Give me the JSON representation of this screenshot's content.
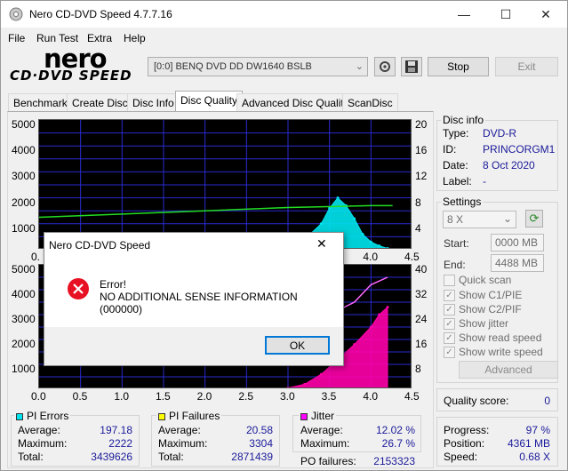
{
  "window": {
    "title": "Nero CD-DVD Speed 4.7.7.16",
    "minimize": "—",
    "maximize": "☐",
    "close": "✕"
  },
  "menu": [
    "File",
    "Run Test",
    "Extra",
    "Help"
  ],
  "logo": {
    "top": "nero",
    "bottom": "CD·DVD SPEED"
  },
  "drive": {
    "selected": "[0:0]   BENQ DVD DD DW1640 BSLB"
  },
  "toolbar": {
    "stop": "Stop",
    "exit": "Exit"
  },
  "tabs": [
    "Benchmark",
    "Create Disc",
    "Disc Info",
    "Disc Quality",
    "Advanced Disc Quality",
    "ScanDisc"
  ],
  "active_tab": "Disc Quality",
  "chart_data": [
    {
      "type": "area",
      "title": "PI Errors / Read speed",
      "xlabel": "",
      "ylabel": "",
      "xlim": [
        0,
        4.5
      ],
      "ylim": [
        0,
        5000
      ],
      "ylim_right": [
        0,
        20
      ],
      "y_ticks_left": [
        "5000",
        "4000",
        "3000",
        "2000",
        "1000"
      ],
      "y_ticks_right": [
        "20",
        "16",
        "12",
        "8",
        "4"
      ],
      "x_ticks_visible": [
        "0.",
        "4.0",
        "4.5"
      ],
      "series": [
        {
          "name": "PI Errors",
          "color": "#00e5ee",
          "x": [
            3.0,
            3.2,
            3.4,
            3.5,
            3.6,
            3.7,
            3.8,
            3.9,
            4.0,
            4.1,
            4.2
          ],
          "values": [
            100,
            400,
            1000,
            1600,
            2000,
            1700,
            1200,
            600,
            300,
            150,
            50
          ]
        },
        {
          "name": "Read speed",
          "color": "#22dd22",
          "x": [
            0,
            1,
            2,
            3,
            4,
            4.2,
            4.26
          ],
          "values": [
            0.5,
            0.55,
            0.6,
            0.65,
            0.68,
            0.68,
            0.68
          ]
        }
      ]
    },
    {
      "type": "area",
      "title": "PI Failures / Jitter",
      "xlabel": "",
      "ylabel": "",
      "xlim": [
        0,
        4.5
      ],
      "ylim": [
        0,
        5000
      ],
      "ylim_right": [
        0,
        40
      ],
      "y_ticks_left": [
        "5000",
        "4000",
        "3000",
        "2000",
        "1000"
      ],
      "y_ticks_right": [
        "40",
        "32",
        "24",
        "16",
        "8"
      ],
      "x_ticks": [
        "0.0",
        "0.5",
        "1.0",
        "1.5",
        "2.0",
        "2.5",
        "3.0",
        "3.5",
        "4.0",
        "4.5"
      ],
      "series": [
        {
          "name": "PI Failures",
          "color": "#ff00aa",
          "x": [
            3.0,
            3.2,
            3.4,
            3.6,
            3.8,
            4.0,
            4.1,
            4.2
          ],
          "values": [
            50,
            200,
            600,
            1200,
            1800,
            2500,
            3000,
            3300
          ]
        },
        {
          "name": "Jitter",
          "color": "#ff66ff",
          "x": [
            3.5,
            3.8,
            4.0,
            4.2
          ],
          "values": [
            3000,
            3500,
            4200,
            4500
          ]
        }
      ]
    }
  ],
  "disc_info": {
    "title": "Disc info",
    "rows": [
      {
        "label": "Type:",
        "value": "DVD-R"
      },
      {
        "label": "ID:",
        "value": "PRINCORGM1"
      },
      {
        "label": "Date:",
        "value": "8 Oct 2020"
      },
      {
        "label": "Label:",
        "value": "-"
      }
    ]
  },
  "settings": {
    "title": "Settings",
    "speed": "8 X",
    "start_label": "Start:",
    "start_value": "0000 MB",
    "end_label": "End:",
    "end_value": "4488 MB",
    "checkboxes": [
      {
        "label": "Quick scan",
        "checked": false
      },
      {
        "label": "Show C1/PIE",
        "checked": true
      },
      {
        "label": "Show C2/PIF",
        "checked": true
      },
      {
        "label": "Show jitter",
        "checked": true
      },
      {
        "label": "Show read speed",
        "checked": true
      },
      {
        "label": "Show write speed",
        "checked": true
      }
    ],
    "advanced": "Advanced"
  },
  "quality": {
    "label": "Quality score:",
    "value": "0"
  },
  "progress": {
    "rows": [
      {
        "label": "Progress:",
        "value": "97 %"
      },
      {
        "label": "Position:",
        "value": "4361 MB"
      },
      {
        "label": "Speed:",
        "value": "0.68 X"
      }
    ]
  },
  "pi_errors": {
    "title": "PI Errors",
    "color": "#00e5ee",
    "rows": [
      {
        "label": "Average:",
        "value": "197.18"
      },
      {
        "label": "Maximum:",
        "value": "2222"
      },
      {
        "label": "Total:",
        "value": "3439626"
      }
    ]
  },
  "pi_failures": {
    "title": "PI Failures",
    "color": "#ffff00",
    "rows": [
      {
        "label": "Average:",
        "value": "20.58"
      },
      {
        "label": "Maximum:",
        "value": "3304"
      },
      {
        "label": "Total:",
        "value": "2871439"
      }
    ]
  },
  "jitter": {
    "title": "Jitter",
    "color": "#ff00ff",
    "rows": [
      {
        "label": "Average:",
        "value": "12.02 %"
      },
      {
        "label": "Maximum:",
        "value": "26.7 %"
      }
    ],
    "po_label": "PO failures:",
    "po_value": "2153323"
  },
  "dialog": {
    "title": "Nero CD-DVD Speed",
    "close": "✕",
    "line1": "Error!",
    "line2": "NO ADDITIONAL SENSE INFORMATION (000000)",
    "ok": "OK"
  }
}
